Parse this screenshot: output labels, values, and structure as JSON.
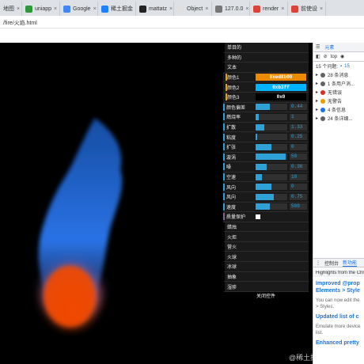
{
  "browser": {
    "tabs": [
      {
        "label": "地图",
        "color": "#4caf50"
      },
      {
        "label": "uniapp",
        "color": "#2b9939"
      },
      {
        "label": "Google",
        "color": "#4285f4"
      },
      {
        "label": "稀土掘金",
        "color": "#1e80ff"
      },
      {
        "label": "mattatz",
        "color": "#222222"
      },
      {
        "label": "Object",
        "color": "#e0e0e0"
      },
      {
        "label": "127.0.0",
        "color": "#777777"
      },
      {
        "label": "render",
        "color": "#db4437"
      },
      {
        "label": "前使设",
        "color": "#db4437"
      }
    ],
    "url": "/fire/火焰.html"
  },
  "gui": {
    "folders_top": [
      "单目的",
      "多种的",
      "文本"
    ],
    "colors": [
      {
        "label": "颜色1",
        "value": "0xed8b00",
        "bg": "#ed8b00",
        "fg": "#ffffff"
      },
      {
        "label": "颜色2",
        "value": "0xb3ff",
        "bg": "#00b3ff",
        "fg": "#ffffff"
      },
      {
        "label": "颜色3",
        "value": "0x0",
        "bg": "#000000",
        "fg": "#ffffff"
      }
    ],
    "numbers": [
      {
        "label": "颜色偏差",
        "value": "0.44",
        "fraction": 0.44
      },
      {
        "label": "燃烧率",
        "value": "1",
        "fraction": 0.1
      },
      {
        "label": "扩散",
        "value": "1.33",
        "fraction": 0.27
      },
      {
        "label": "粘度",
        "value": "0.25",
        "fraction": 0.05
      },
      {
        "label": "扩张",
        "value": "0",
        "fraction": 0.5
      },
      {
        "label": "漩涡",
        "value": "50",
        "fraction": 0.95
      },
      {
        "label": "噪",
        "value": "0.36",
        "fraction": 0.36
      },
      {
        "label": "空速",
        "value": "10",
        "fraction": 0.2
      },
      {
        "label": "风向",
        "value": "0",
        "fraction": 0.5
      },
      {
        "label": "风向",
        "value": "0.75",
        "fraction": 0.58
      },
      {
        "label": "速度",
        "value": "500",
        "fraction": 0.45
      }
    ],
    "bool": {
      "label": "质量保护",
      "checked": true
    },
    "folders_bottom": [
      "蜡烛",
      "火炬",
      "营火",
      "火球",
      "冰球",
      "抽象",
      "湿疹"
    ],
    "close_label": "关闭控件"
  },
  "devtools": {
    "tabs": [
      "元素"
    ],
    "filter": "top",
    "issues": "15 个问题:",
    "issues_count": "15",
    "messages": [
      {
        "text": "28 条消息",
        "color": "#5f6368"
      },
      {
        "text": "1 条用户消...",
        "color": "#5f6368"
      },
      {
        "text": "无错误",
        "color": "#d93025"
      },
      {
        "text": "无警告",
        "color": "#f29900"
      },
      {
        "text": "4 条信息",
        "color": "#1a73e8"
      },
      {
        "text": "24 条详细...",
        "color": "#5f6368"
      }
    ],
    "lower_tabs": [
      "控制台",
      "新功能"
    ],
    "whatsnew_header": "Highlights from the Chr",
    "items": [
      {
        "title": "Improved @prop",
        "title2": "Elements > Style",
        "body": "You can now edit the",
        "body2": "> Styles."
      },
      {
        "title": "Updated list of c",
        "title2": "",
        "body": "Emulate more device",
        "body2": "list."
      }
    ],
    "trailing": "Enhanced pretty"
  },
  "watermark": "@稀土掘金技术社区"
}
